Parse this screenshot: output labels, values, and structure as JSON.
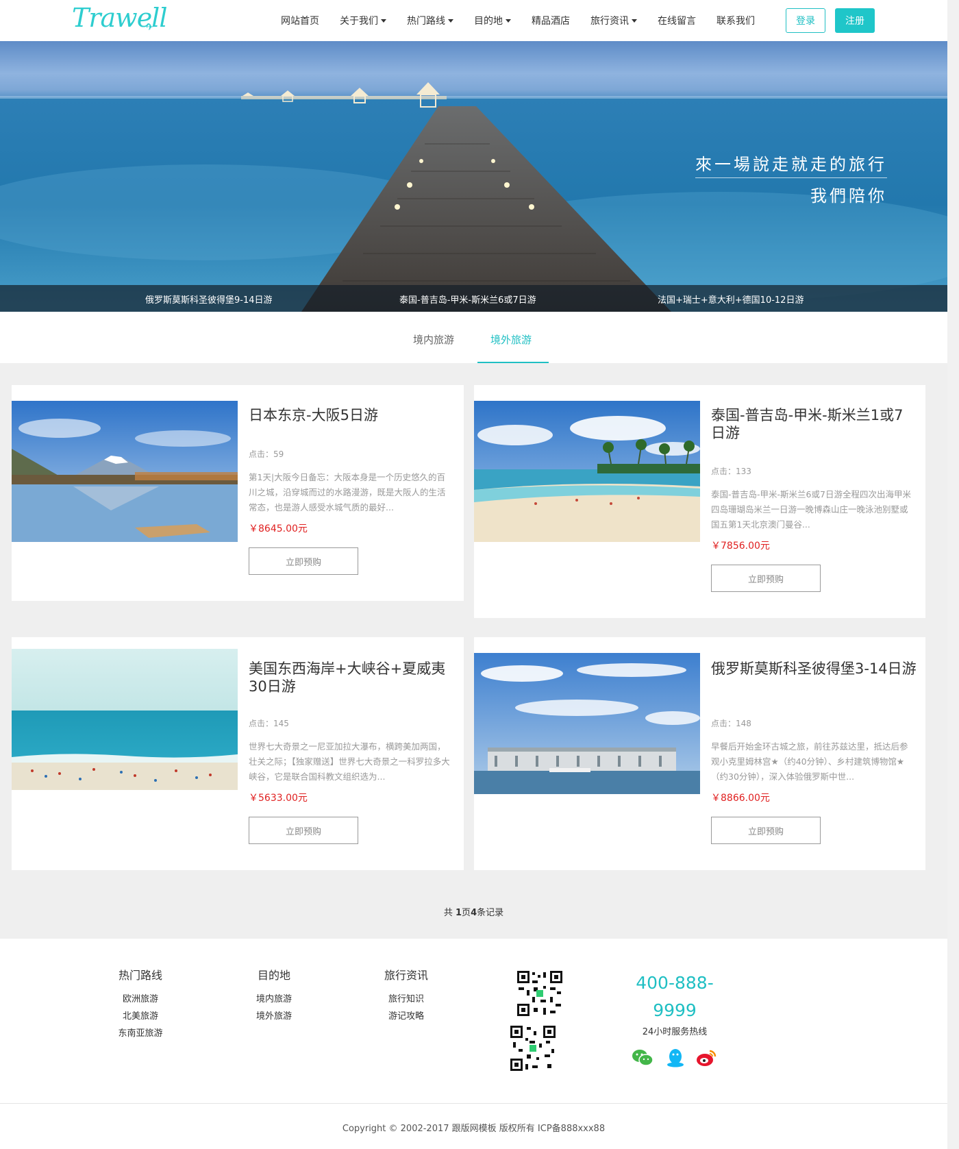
{
  "brand": {
    "logo_text": "Trawell"
  },
  "nav": {
    "items": [
      {
        "label": "网站首页",
        "dropdown": false
      },
      {
        "label": "关于我们",
        "dropdown": true
      },
      {
        "label": "热门路线",
        "dropdown": true
      },
      {
        "label": "目的地",
        "dropdown": true
      },
      {
        "label": "精品酒店",
        "dropdown": false
      },
      {
        "label": "旅行资讯",
        "dropdown": true
      },
      {
        "label": "在线留言",
        "dropdown": false
      },
      {
        "label": "联系我们",
        "dropdown": false
      }
    ],
    "login_label": "登录",
    "register_label": "注册"
  },
  "hero": {
    "slogan_line1": "來一場說走就走的旅行",
    "slogan_line2": "我們陪你",
    "captions": [
      "俄罗斯莫斯科圣彼得堡9-14日游",
      "泰国-普吉岛-甲米-斯米兰6或7日游",
      "法国+瑞士+意大利+德国10-12日游"
    ]
  },
  "tabs": [
    {
      "label": "境内旅游",
      "active": false
    },
    {
      "label": "境外旅游",
      "active": true
    }
  ],
  "products": [
    {
      "title": "日本东京-大阪5日游",
      "clicks": "点击：59",
      "desc": "第1天|大阪今日备忘：大阪本身是一个历史悠久的百川之城，沿穿城而过的水路漫游，既是大阪人的生活常态，也是游人感受水城气质的最好...",
      "price": "￥8645.00元",
      "button": "立即预购",
      "image": "mount-fuji-lake"
    },
    {
      "title": "泰国-普吉岛-甲米-斯米兰1或7日游",
      "clicks": "点击：133",
      "desc": "泰国-普吉岛-甲米-斯米兰6或7日游全程四次出海甲米四岛珊瑚岛米兰一日游一晚博森山庄一晚泳池别墅或国五第1天北京澳门曼谷...",
      "price": "￥7856.00元",
      "button": "立即预购",
      "image": "tropical-beach"
    },
    {
      "title": "美国东西海岸+大峡谷+夏威夷30日游",
      "clicks": "点击：145",
      "desc": "世界七大奇景之一尼亚加拉大瀑布，横跨美加两国，壮关之际；【独家赠送】世界七大奇景之一科罗拉多大峡谷，它是联合国科教文组织选为...",
      "price": "￥5633.00元",
      "button": "立即预购",
      "image": "ocean-beach"
    },
    {
      "title": "俄罗斯莫斯科圣彼得堡3-14日游",
      "clicks": "点击：148",
      "desc": "早餐后开始金环古城之旅，前往苏兹达里，抵达后参观小克里姆林宫★（约40分钟）、乡村建筑博物馆★（约30分钟），深入体验俄罗斯中世...",
      "price": "￥8866.00元",
      "button": "立即预购",
      "image": "winter-palace"
    }
  ],
  "pager": {
    "prefix": "共 ",
    "pages": "1",
    "mid": "页",
    "records": "4",
    "suffix": "条记录"
  },
  "footer": {
    "columns": [
      {
        "title": "热门路线",
        "links": [
          "欧洲旅游",
          "北美旅游",
          "东南亚旅游"
        ]
      },
      {
        "title": "目的地",
        "links": [
          "境内旅游",
          "境外旅游"
        ]
      },
      {
        "title": "旅行资讯",
        "links": [
          "旅行知识",
          "游记攻略"
        ]
      }
    ],
    "phone_line1": "400-888-",
    "phone_line2": "9999",
    "phone_caption": "24小时服务热线",
    "social_icons": [
      "wechat-icon",
      "qq-icon",
      "weibo-icon"
    ],
    "copyright": "Copyright © 2002-2017 跟版网模板 版权所有 ICP备888xxx88"
  },
  "colors": {
    "accent": "#1fbfc3",
    "price": "#e02020",
    "page_bg": "#efefef"
  }
}
